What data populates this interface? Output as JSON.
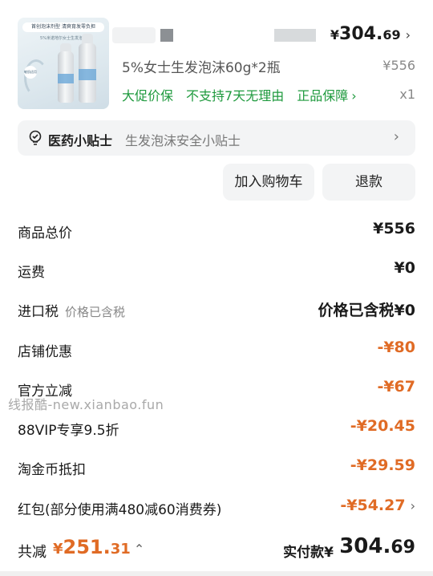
{
  "product": {
    "image_text_1": "首创泡沫剂型 清爽育发零负担",
    "image_text_2": "5%米诺地尔女士生发泡沫",
    "image_badge": "敏肌适用",
    "price_currency": "¥",
    "price_int": "304.",
    "price_dec": "69",
    "name": "5%女士生发泡沫60g*2瓶",
    "original_price": "¥556",
    "tags": [
      "大促价保",
      "不支持7天无理由",
      "正品保障"
    ],
    "quantity": "x1"
  },
  "tip": {
    "title": "医药小贴士",
    "text": "生发泡沫安全小贴士"
  },
  "actions": {
    "add_to_cart": "加入购物车",
    "refund": "退款"
  },
  "fees": [
    {
      "label": "商品总价",
      "hint": "",
      "value": "¥556",
      "color": "black"
    },
    {
      "label": "运费",
      "hint": "",
      "value": "¥0",
      "color": "black"
    },
    {
      "label": "进口税",
      "hint": "价格已含税",
      "value": "价格已含税¥0",
      "color": "black"
    },
    {
      "label": "店铺优惠",
      "hint": "",
      "value": "-¥80",
      "color": "orange"
    },
    {
      "label": "官方立减",
      "hint": "",
      "value": "-¥67",
      "color": "orange"
    },
    {
      "label": "88VIP专享9.5折",
      "hint": "",
      "value": "-¥20.45",
      "color": "orange"
    },
    {
      "label": "淘金币抵扣",
      "hint": "",
      "value": "-¥29.59",
      "color": "orange"
    },
    {
      "label": "红包(部分使用满480减60消费券)",
      "hint": "",
      "value": "-¥54.27",
      "color": "orange"
    }
  ],
  "watermark": "线报酷-new.xianbao.fun",
  "footer": {
    "saved_label": "共减",
    "saved_currency": "¥",
    "saved_int": "251.",
    "saved_dec": "31",
    "pay_label": "实付款¥",
    "pay_int": "304.",
    "pay_dec": "69"
  },
  "colors": {
    "accent_orange": "#e06b25",
    "tag_green": "#1f9a3e"
  }
}
